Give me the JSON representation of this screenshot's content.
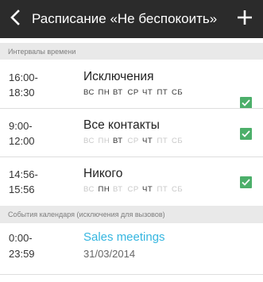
{
  "header": {
    "title": "Расписание «Не беспокоить»",
    "back_icon": "chevron-left-icon",
    "add_icon": "plus-icon"
  },
  "sections": {
    "intervals": "Интервалы времени",
    "calendar": "События календаря (исключения для вызовов)"
  },
  "intervals": [
    {
      "time": "16:00-\n18:30",
      "title": "Исключения",
      "days": [
        {
          "label": "ВС",
          "on": true
        },
        {
          "label": "ПН",
          "on": true
        },
        {
          "label": "ВТ",
          "on": true
        },
        {
          "label": "СР",
          "on": true
        },
        {
          "label": "ЧТ",
          "on": true
        },
        {
          "label": "ПТ",
          "on": true
        },
        {
          "label": "СБ",
          "on": true
        }
      ],
      "checked": true
    },
    {
      "time": "9:00-\n12:00",
      "title": "Все контакты",
      "days": [
        {
          "label": "ВС",
          "on": false
        },
        {
          "label": "ПН",
          "on": false
        },
        {
          "label": "ВТ",
          "on": true
        },
        {
          "label": "СР",
          "on": false
        },
        {
          "label": "ЧТ",
          "on": true
        },
        {
          "label": "ПТ",
          "on": false
        },
        {
          "label": "СБ",
          "on": false
        }
      ],
      "checked": true
    },
    {
      "time": "14:56-\n15:56",
      "title": "Никого",
      "days": [
        {
          "label": "ВС",
          "on": false
        },
        {
          "label": "ПН",
          "on": true
        },
        {
          "label": "ВТ",
          "on": false
        },
        {
          "label": "СР",
          "on": false
        },
        {
          "label": "ЧТ",
          "on": true
        },
        {
          "label": "ПТ",
          "on": false
        },
        {
          "label": "СБ",
          "on": false
        }
      ],
      "checked": true
    }
  ],
  "calendar_events": [
    {
      "time": "0:00-\n23:59",
      "title": "Sales meetings",
      "date": "31/03/2014"
    }
  ],
  "colors": {
    "header_bg": "#2b2b2b",
    "accent_green": "#4caf6a",
    "accent_blue": "#35b6e0",
    "section_bg": "#e9e9e9"
  }
}
